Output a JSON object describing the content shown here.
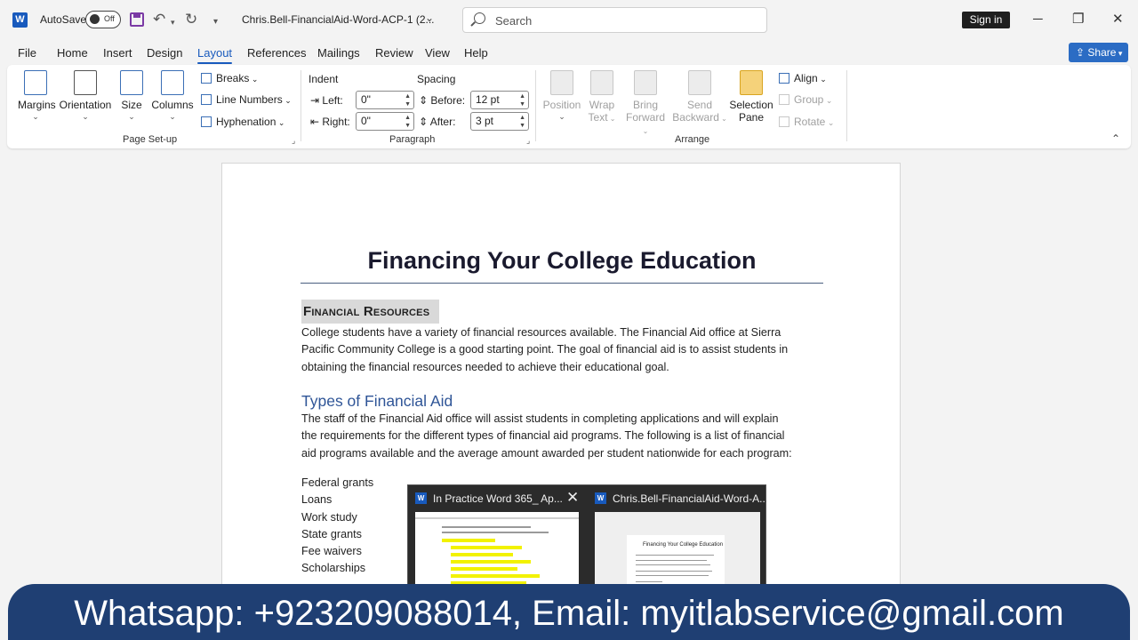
{
  "titlebar": {
    "app_letter": "W",
    "autosave_label": "AutoSave",
    "autosave_state": "Off",
    "doc_title": "Chris.Bell-FinancialAid-Word-ACP-1 (2...",
    "search_placeholder": "Search",
    "signin_label": "Sign in"
  },
  "tabs": [
    "File",
    "Home",
    "Insert",
    "Design",
    "Layout",
    "References",
    "Mailings",
    "Review",
    "View",
    "Help"
  ],
  "active_tab": "Layout",
  "share_label": "Share",
  "ribbon": {
    "page_setup": {
      "margins": "Margins",
      "orientation": "Orientation",
      "size": "Size",
      "columns": "Columns",
      "breaks": "Breaks",
      "line_numbers": "Line Numbers",
      "hyphenation": "Hyphenation",
      "label": "Page Set-up"
    },
    "paragraph": {
      "indent_label": "Indent",
      "spacing_label": "Spacing",
      "left_label": "Left:",
      "left_value": "0\"",
      "right_label": "Right:",
      "right_value": "0\"",
      "before_label": "Before:",
      "before_value": "12 pt",
      "after_label": "After:",
      "after_value": "3 pt",
      "label": "Paragraph"
    },
    "arrange": {
      "position": "Position",
      "wrap_text_1": "Wrap",
      "wrap_text_2": "Text",
      "bring_forward_1": "Bring",
      "bring_forward_2": "Forward",
      "send_backward_1": "Send",
      "send_backward_2": "Backward",
      "selection_pane_1": "Selection",
      "selection_pane_2": "Pane",
      "align": "Align",
      "group": "Group",
      "rotate": "Rotate",
      "label": "Arrange"
    }
  },
  "document": {
    "title": "Financing Your College Education",
    "section_heading": "Financial Resources",
    "para1_l1": "College students have a variety of financial resources available. The Financial Aid office at Sierra",
    "para1_l2": "Pacific Community College is a good starting point. The goal of financial aid is to assist students in",
    "para1_l3": "obtaining the financial resources needed to achieve their educational goal.",
    "subheading": "Types of Financial Aid",
    "para2_l1": "The staff of the Financial Aid office will assist students in completing applications and will explain",
    "para2_l2": "the requirements for the different types of financial aid programs. The following is a list of financial",
    "para2_l3": "aid programs available and the average amount awarded per student nationwide for each program:",
    "list": [
      "Federal grants",
      "Loans",
      "Work study",
      "State grants",
      "Fee waivers",
      "Scholarships"
    ]
  },
  "taskbar_preview": {
    "item1_title": "In Practice Word 365_ Ap...",
    "item2_title": "Chris.Bell-FinancialAid-Word-A...",
    "thumb2_heading": "Financing Your College Education"
  },
  "banner_text": "Whatsapp: +923209088014, Email: myitlabservice@gmail.com",
  "colors": {
    "word_blue": "#185abd",
    "heading_blue": "#2f5597",
    "banner_bg": "#1f3f73",
    "highlight_yellow": "#f2f200"
  }
}
